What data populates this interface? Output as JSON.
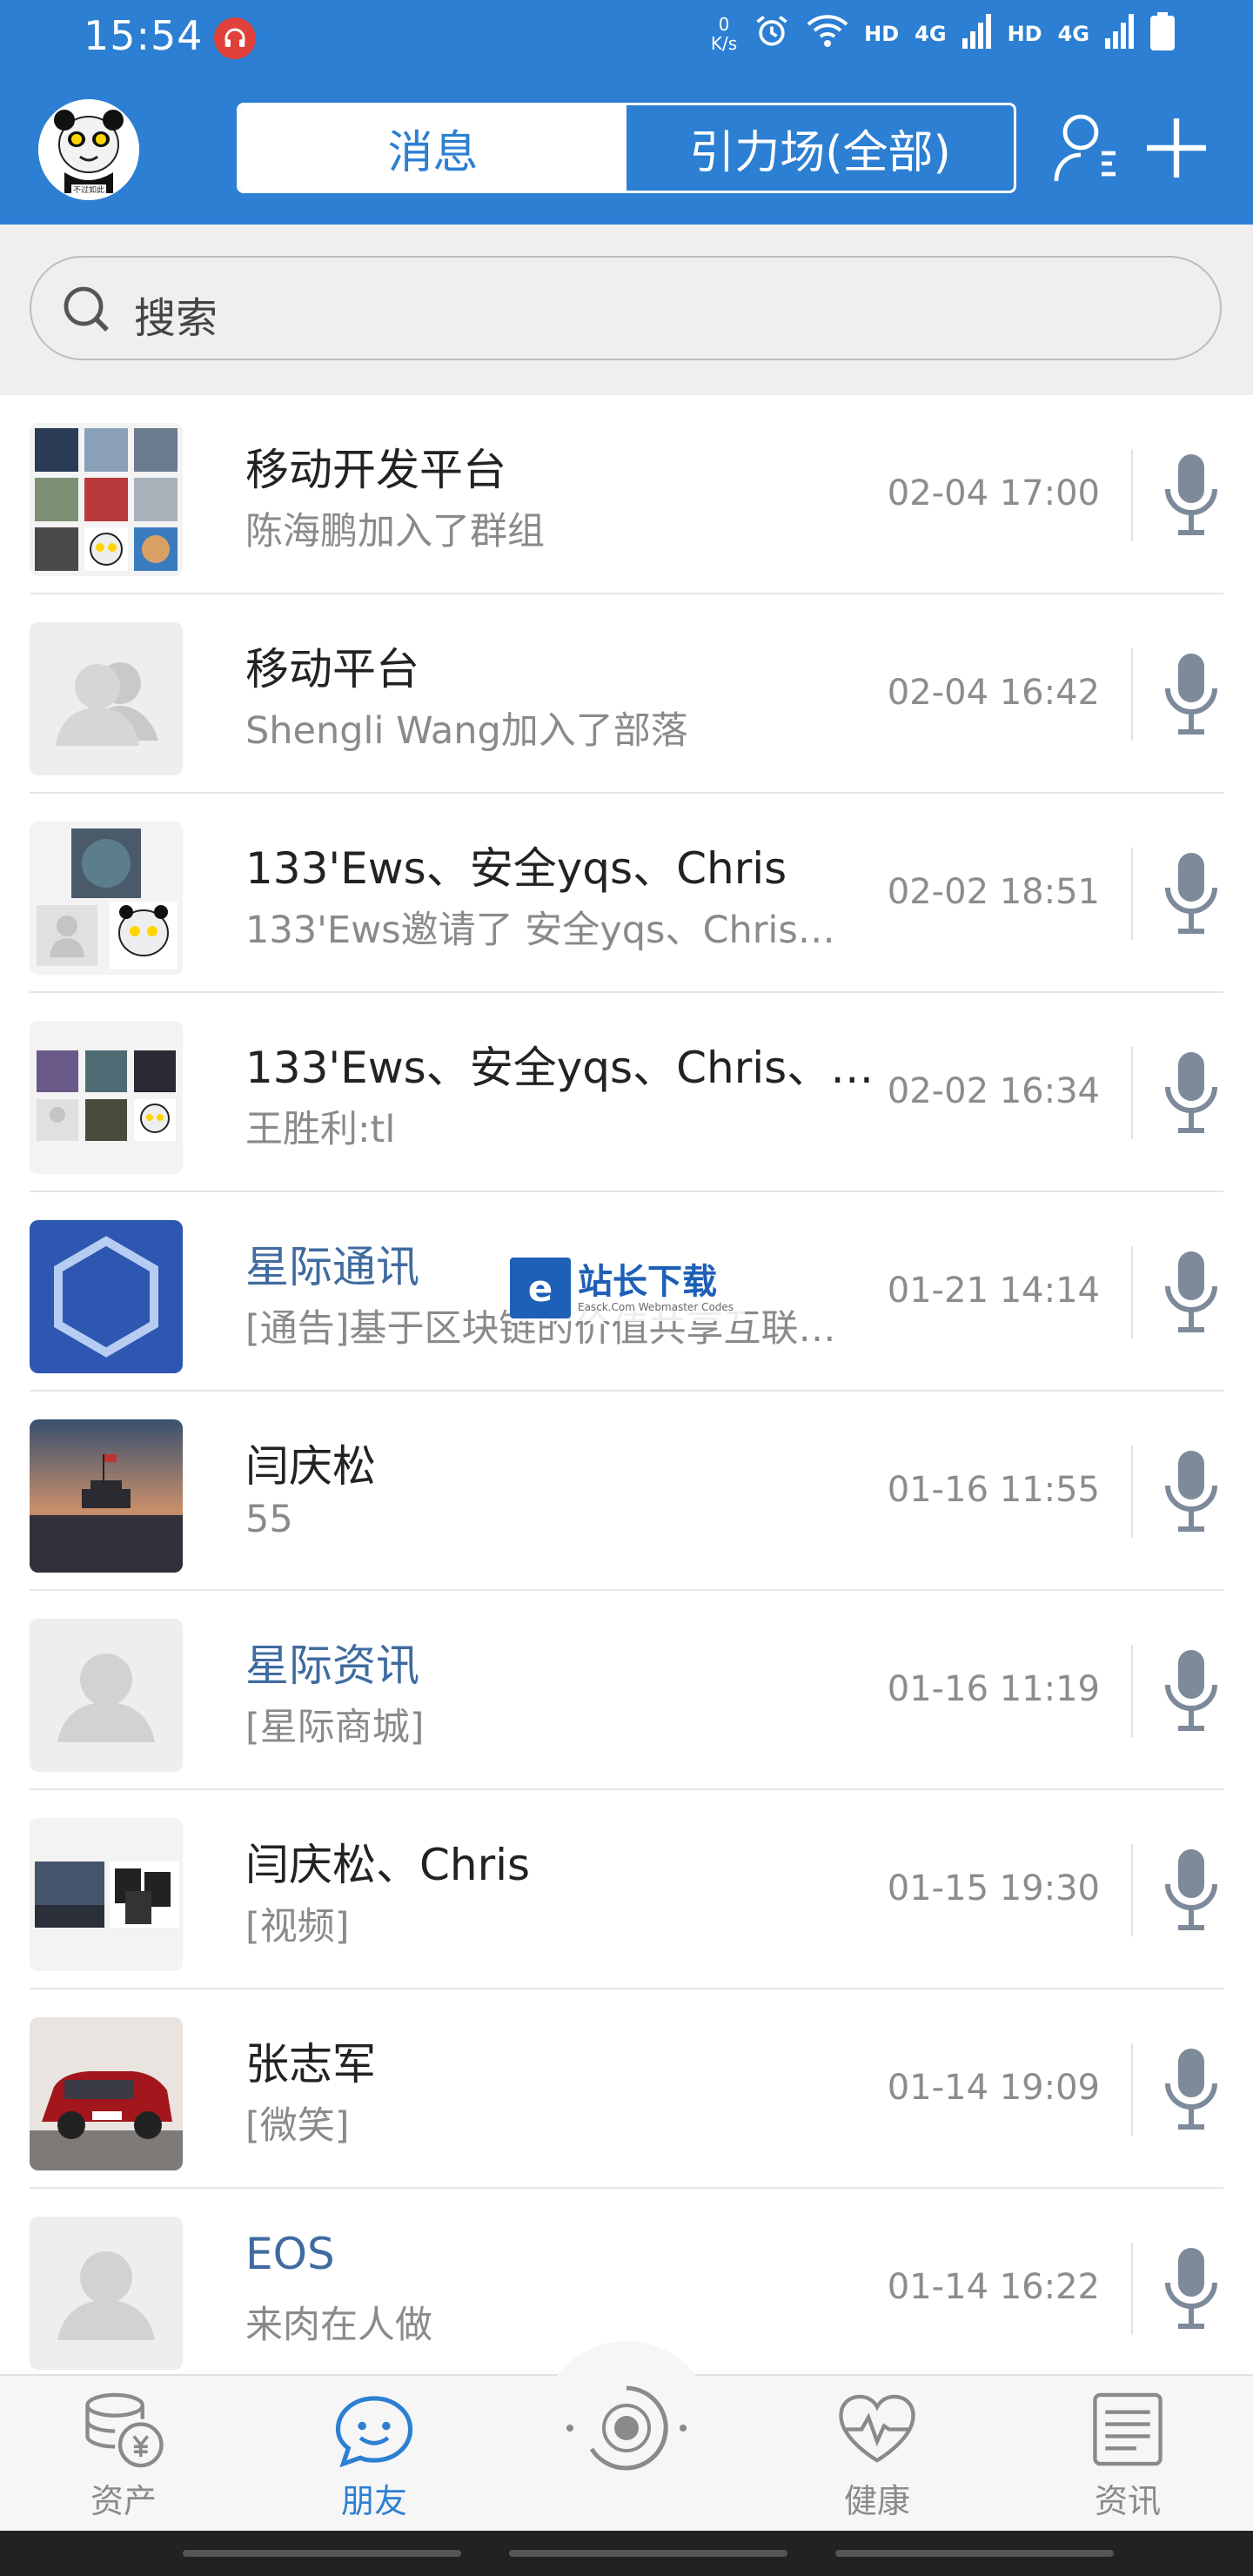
{
  "status_bar": {
    "time": "15:54",
    "net_speed_value": "0",
    "net_speed_unit": "K/s",
    "hd1": "HD",
    "lte1": "4G",
    "hd2": "HD",
    "lte2": "4G"
  },
  "header": {
    "avatar_caption": "不过如此",
    "tab_messages": "消息",
    "tab_gravity": "引力场(全部)"
  },
  "search": {
    "placeholder": "搜索"
  },
  "conversations": [
    {
      "name": "移动开发平台",
      "subtitle": "陈海鹏加入了群组",
      "time": "02-04 17:00",
      "name_color": "default"
    },
    {
      "name": "移动平台",
      "subtitle": "Shengli Wang加入了部落",
      "time": "02-04 16:42",
      "name_color": "default"
    },
    {
      "name": "133'Ews、安全yqs、Chris",
      "subtitle": "133'Ews邀请了 安全yqs、Chris…",
      "time": "02-02 18:51",
      "name_color": "default"
    },
    {
      "name": "133'Ews、安全yqs、Chris、…",
      "subtitle": "王胜利:tl",
      "time": "02-02 16:34",
      "name_color": "default"
    },
    {
      "name": "星际通讯",
      "subtitle": "[通告]基于区块链的价值共享互联…",
      "time": "01-21 14:14",
      "name_color": "link"
    },
    {
      "name": "闫庆松",
      "subtitle": "55",
      "time": "01-16 11:55",
      "name_color": "default"
    },
    {
      "name": "星际资讯",
      "subtitle": "[星际商城]",
      "time": "01-16 11:19",
      "name_color": "link"
    },
    {
      "name": "闫庆松、Chris",
      "subtitle": "[视频]",
      "time": "01-15 19:30",
      "name_color": "default"
    },
    {
      "name": "张志军",
      "subtitle": "[微笑]",
      "time": "01-14 19:09",
      "name_color": "default"
    },
    {
      "name": "EOS",
      "subtitle": "来肉在人做",
      "time": "01-14 16:22",
      "name_color": "link"
    }
  ],
  "watermark": {
    "title": "站长下载",
    "subtitle": "Easck.Com Webmaster Codes"
  },
  "bottom_nav": {
    "assets": "资产",
    "friends": "朋友",
    "health": "健康",
    "news": "资讯"
  },
  "colors": {
    "brand": "#2c7fd2",
    "link_name": "#3f6b9f",
    "muted": "#8a8a8a"
  }
}
